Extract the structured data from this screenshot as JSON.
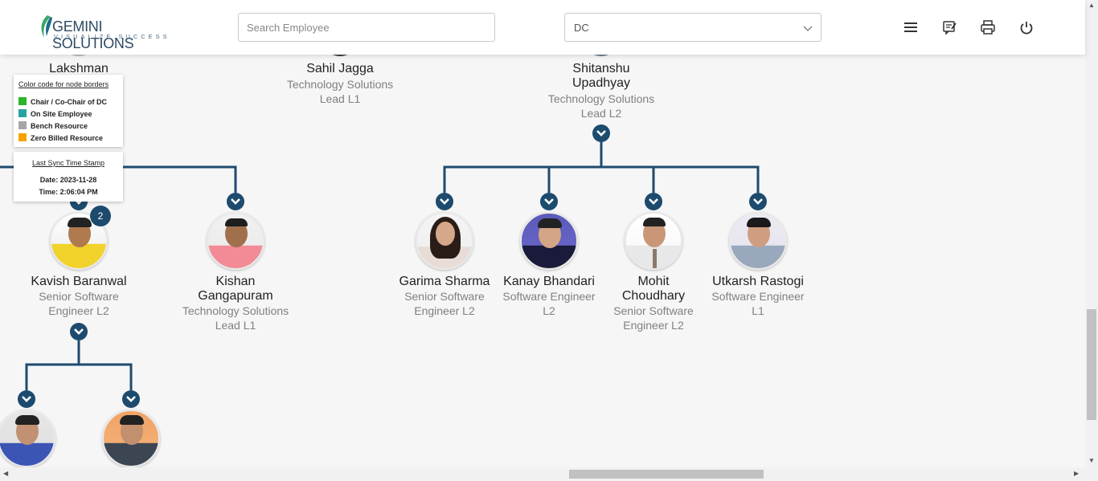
{
  "header": {
    "logo_brand": "GEMINI SOLUTIONS",
    "logo_tagline": "VISUALIZE SUCCESS",
    "search_placeholder": "Search Employee",
    "dc_select_value": "DC",
    "icons": [
      "menu-icon",
      "feedback-icon",
      "print-icon",
      "power-icon"
    ]
  },
  "colors": {
    "accent": "#1d4b6e",
    "chair": "#2bb52b",
    "onsite": "#2aa3a0",
    "bench": "#a6a6a6",
    "zero_billed": "#f5a300"
  },
  "legend": {
    "title": "Color code for node borders",
    "items": [
      "Chair / Co-Chair of DC",
      "On Site Employee",
      "Bench Resource",
      "Zero Billed Resource"
    ]
  },
  "sync": {
    "title": "Last Sync Time Stamp",
    "date": "Date: 2023-11-28",
    "time": "Time: 2:06:04 PM"
  },
  "top_nodes": [
    {
      "name": "Lakshman",
      "role": ""
    },
    {
      "name": "Sahil Jagga",
      "role": "Technology Solutions Lead L1"
    },
    {
      "name": "Shitanshu Upadhyay",
      "role": "Technology Solutions Lead L2"
    }
  ],
  "employees": [
    {
      "name": "Kavish Baranwal",
      "role": "Senior Software Engineer L2",
      "badge": "2"
    },
    {
      "name": "Kishan Gangapuram",
      "role": "Technology Solutions Lead L1"
    },
    {
      "name": "Garima Sharma",
      "role": "Senior Software Engineer L2"
    },
    {
      "name": "Kanay Bhandari",
      "role": "Software Engineer L2"
    },
    {
      "name": "Mohit Choudhary",
      "role": "Senior Software Engineer L2"
    },
    {
      "name": "Utkarsh Rastogi",
      "role": "Software Engineer L1"
    }
  ]
}
